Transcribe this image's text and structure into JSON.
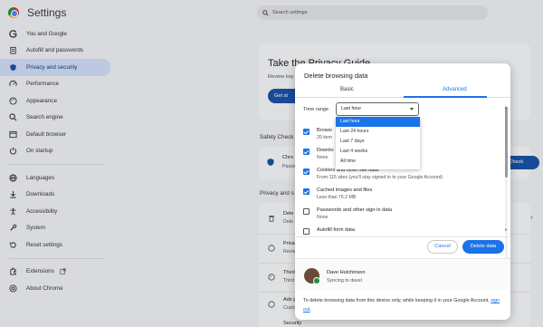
{
  "app": {
    "title": "Settings"
  },
  "search": {
    "placeholder": "Search settings"
  },
  "sidebar": {
    "items": [
      {
        "label": "You and Google",
        "icon": "google-g-icon"
      },
      {
        "label": "Autofill and passwords",
        "icon": "clipboard-icon"
      },
      {
        "label": "Privacy and security",
        "icon": "shield-icon",
        "active": true
      },
      {
        "label": "Performance",
        "icon": "speedometer-icon"
      },
      {
        "label": "Appearance",
        "icon": "palette-icon"
      },
      {
        "label": "Search engine",
        "icon": "search-icon"
      },
      {
        "label": "Default browser",
        "icon": "browser-icon"
      },
      {
        "label": "On startup",
        "icon": "power-icon"
      },
      {
        "label": "Languages",
        "icon": "globe-icon"
      },
      {
        "label": "Downloads",
        "icon": "download-icon"
      },
      {
        "label": "Accessibility",
        "icon": "accessibility-icon"
      },
      {
        "label": "System",
        "icon": "wrench-icon"
      },
      {
        "label": "Reset settings",
        "icon": "reset-icon"
      },
      {
        "label": "Extensions",
        "icon": "puzzle-icon"
      },
      {
        "label": "About Chrome",
        "icon": "chrome-icon"
      }
    ]
  },
  "background": {
    "privacy_guide_title": "Take the Privacy Guide",
    "privacy_guide_sub": "Review key",
    "get_started": "Get st",
    "safety_check": "Safety Check",
    "safety_row_title": "Chro",
    "safety_row_sub": "Passw",
    "check_now": "y Check",
    "privacy_section": "Privacy and s",
    "rows": [
      {
        "title": "Dele",
        "sub": "Dele"
      },
      {
        "title": "Priva",
        "sub": "Revie"
      },
      {
        "title": "Third",
        "sub": "Third"
      },
      {
        "title": "Ads p",
        "sub": "Custo"
      },
      {
        "title": "Security",
        "sub": ""
      }
    ]
  },
  "dialog": {
    "title": "Delete browsing data",
    "tabs": [
      "Basic",
      "Advanced"
    ],
    "time_range_label": "Time range",
    "time_range_value": "Last hour",
    "time_options": [
      "Last hour",
      "Last 24 hours",
      "Last 7 days",
      "Last 4 weeks",
      "All time"
    ],
    "items": [
      {
        "title": "Browsi",
        "sub": "20 item",
        "checked": true
      },
      {
        "title": "Downlo",
        "sub": "None",
        "checked": true
      },
      {
        "title": "Cookies and other site data",
        "sub": "From 115 sites (you'll stay signed in to your Google Account)",
        "checked": true
      },
      {
        "title": "Cached images and files",
        "sub": "Less than 76.2 MB",
        "checked": true
      },
      {
        "title": "Passwords and other sign-in data",
        "sub": "None",
        "checked": false
      },
      {
        "title": "Autofill form data",
        "sub": "",
        "checked": false
      }
    ],
    "cancel_label": "Cancel",
    "delete_label": "Delete data",
    "profile": {
      "name": "Dave Hutchinson",
      "status": "Syncing to davel"
    },
    "footer_text": "To delete browsing data from this device only, while keeping it in your Google Account, ",
    "footer_link": "sign out",
    "footer_end": "."
  }
}
